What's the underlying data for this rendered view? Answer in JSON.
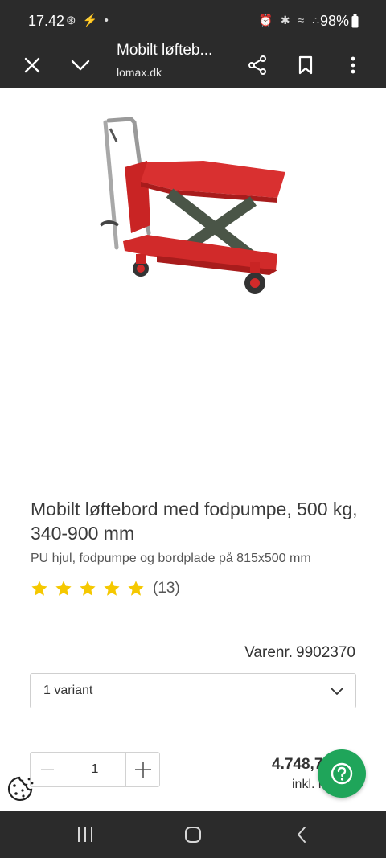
{
  "status_bar": {
    "time": "17.42",
    "left_icons": "⊛ ⚡ •",
    "right_icons": "⏰ ✱ ≈ ∴",
    "battery": "98%"
  },
  "toolbar": {
    "page_title": "Mobilt løfteb...",
    "url": "lomax.dk"
  },
  "product": {
    "title": "Mobilt løftebord med fodpumpe, 500 kg, 340-900 mm",
    "subtitle": "PU hjul, fodpumpe og bordplade på 815x500 mm",
    "rating": 5,
    "rating_count": "(13)",
    "sku_label": "Varenr.",
    "sku": "9902370",
    "variant": "1 variant",
    "quantity": "1",
    "price": "4.748,7",
    "price_note": "inkl. m"
  },
  "colors": {
    "bar_bg": "#2b2b2b",
    "star": "#f5c800",
    "help_button": "#1fa55a",
    "product_red": "#d62b2b"
  }
}
